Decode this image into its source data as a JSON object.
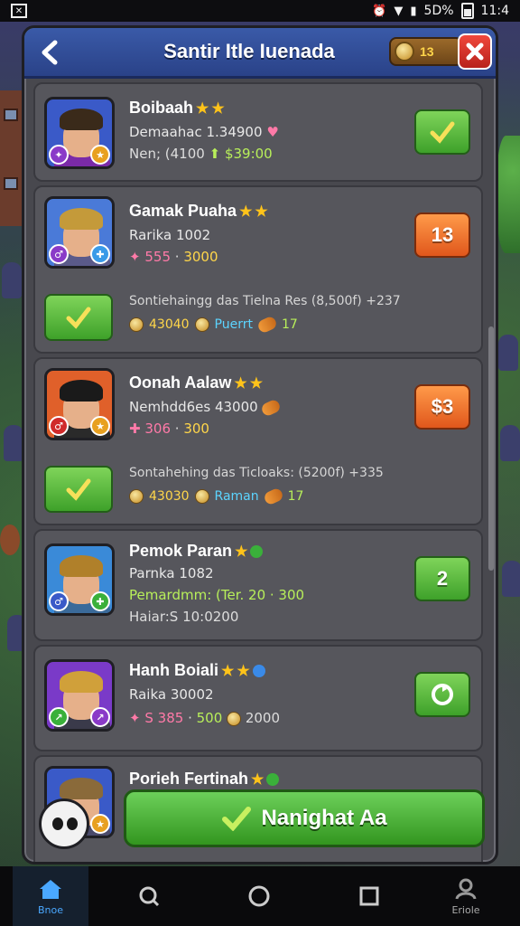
{
  "status_bar": {
    "battery_text": "5D%",
    "time": "11:4"
  },
  "header": {
    "title": "Santir Itle Iuenada",
    "coins": "13"
  },
  "players": [
    {
      "name": "Boibaah",
      "line2": "Demaahac 1.34900",
      "line3_a": "Nen; (4100",
      "line3_b": "$39:00",
      "action": "check",
      "colors": {
        "bg": "#3a5ac8",
        "hair": "#3a2a1a",
        "shirt": "#7a2aa8"
      }
    },
    {
      "name": "Gamak Puaha",
      "line2": "Rarika 1002",
      "line3_a": "555",
      "line3_b": "3000",
      "action_label": "13",
      "sub_text": "Sontiehaingg das Tielna Res (8,500f) +237",
      "sub_cost": "43040",
      "sub_reward": "Puerrt",
      "sub_count": "17",
      "colors": {
        "bg": "#4a7ad8",
        "hair": "#c49a3a",
        "shirt": "#5a5a8a"
      }
    },
    {
      "name": "Oonah Aalaw",
      "line2": "Nemhdd6es 43000",
      "line3_a": "306",
      "line3_b": "300",
      "action_label": "$3",
      "sub_text": "Sontahehing das Ticloaks: (5200f) +335",
      "sub_cost": "43030",
      "sub_reward": "Raman",
      "sub_count": "17",
      "colors": {
        "bg": "#e0602a",
        "hair": "#1a1a1a",
        "shirt": "#2a2a2a"
      }
    },
    {
      "name": "Pemok Paran",
      "line2": "Parnka 1082",
      "line3": "Pemardmm: (Ter. 20 · 300",
      "line4": "Haiar:S 10:0200",
      "action_label": "2",
      "colors": {
        "bg": "#3a8ad8",
        "hair": "#b0802a",
        "shirt": "#3a6a9a"
      }
    },
    {
      "name": "Hanh Boiali",
      "line2": "Raika 30002",
      "line3_a": "S 385",
      "line3_b": "500",
      "line3_c": "2000",
      "action": "swap",
      "colors": {
        "bg": "#7a3ac8",
        "hair": "#d0a03a",
        "shirt": "#3a3a4a"
      }
    },
    {
      "name": "Porieh Fertinah",
      "colors": {
        "bg": "#3a5ac8",
        "hair": "#8a6a3a",
        "shirt": "#4a4a6a"
      }
    }
  ],
  "main_button": {
    "label": "Nanighat Aa"
  },
  "nav": {
    "home_label": "Bnoe",
    "profile_label": "Eriole"
  },
  "theme": {
    "accent_green": "#3ea12a",
    "accent_orange": "#e0571c",
    "header_blue": "#2a4288",
    "close_red": "#d0322a"
  }
}
